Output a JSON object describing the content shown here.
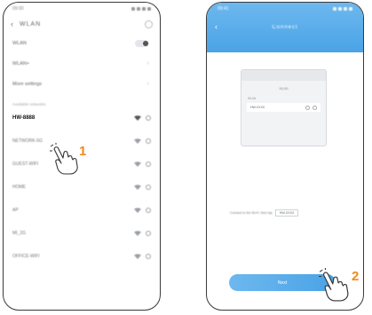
{
  "left_phone": {
    "status_time": "09:00",
    "nav_title": "WLAN",
    "back_glyph": "‹",
    "settings": [
      {
        "label": "WLAN",
        "control": "toggle"
      },
      {
        "label": "WLAN+",
        "control": "chevron"
      },
      {
        "label": "More settings",
        "control": "chevron"
      }
    ],
    "section_label": "Available networks",
    "networks": [
      {
        "name": "HW-8888",
        "selected": true
      },
      {
        "name": "NETWORK-5G",
        "selected": false
      },
      {
        "name": "GUEST-WIFI",
        "selected": false
      },
      {
        "name": "HOME",
        "selected": false
      },
      {
        "name": "AP",
        "selected": false
      },
      {
        "name": "MI_2G",
        "selected": false
      },
      {
        "name": "OFFICE-WIFI",
        "selected": false
      }
    ],
    "step_number": "1"
  },
  "right_phone": {
    "status_time": "09:41",
    "title": "Connect",
    "back_glyph": "‹",
    "mini_title": "WLAN",
    "mini_label": "WLAN",
    "mini_network": "HW-XXXX",
    "instruction_text": "Connect to the Wi-Fi, then tap",
    "instruction_value": "HW-XXXX",
    "button_label": "Next",
    "step_number": "2"
  },
  "colors": {
    "accent_blue": "#4aa3e6",
    "step_orange": "#f08a1c"
  },
  "icons": [
    "hand-pointer-icon",
    "wifi-icon",
    "info-icon",
    "back-arrow-icon"
  ]
}
